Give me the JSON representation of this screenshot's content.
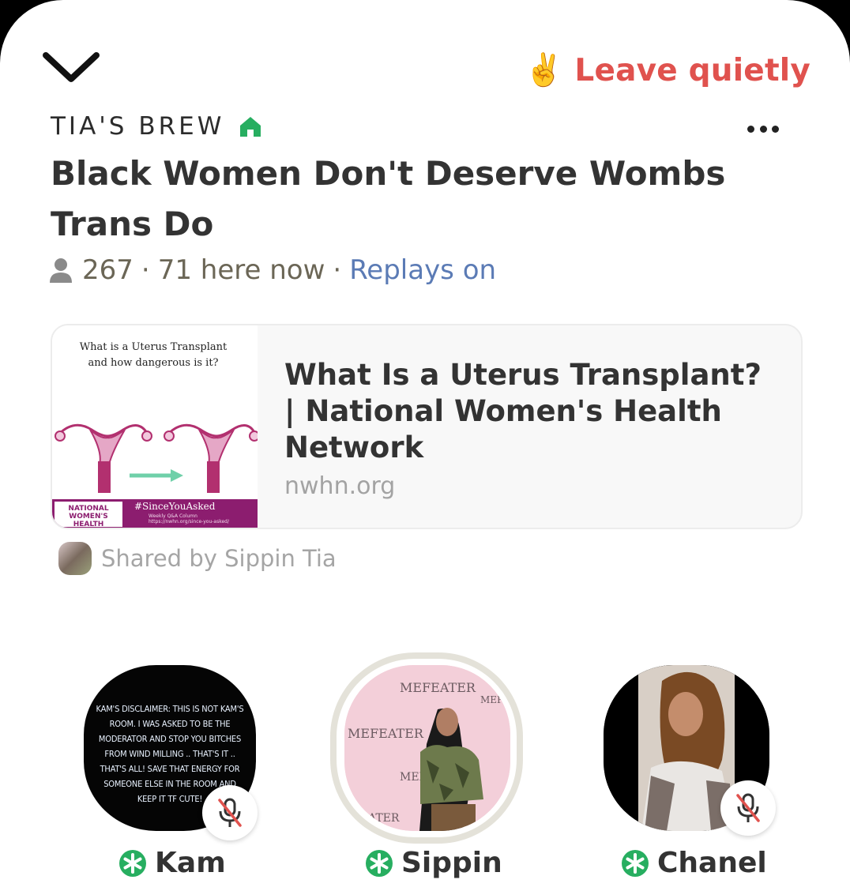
{
  "header": {
    "leave_label": "Leave quietly",
    "leave_emoji": "✌️"
  },
  "room": {
    "club_name": "TIA'S BREW",
    "title": "Black Women Don't Deserve Wombs Trans Do",
    "listener_count": "267",
    "here_now": "71 here now",
    "replays": "Replays on"
  },
  "link_card": {
    "thumbnail_caption": "What is a Uterus Transplant and how dangerous is it?",
    "thumbnail_org": "NATIONAL WOMEN'S HEALTH NETWORK",
    "thumbnail_tag": "#SinceYouAsked",
    "thumbnail_subtag": "Weekly Q&A Column https://nwhn.org/since-you-asked/",
    "title": "What Is a Uterus Transplant? | National Women's Health Network",
    "domain": "nwhn.org"
  },
  "shared_by": "Shared by Sippin Tia",
  "speakers": [
    {
      "name": "Kam",
      "avatar_text": "KAM'S DISCLAIMER: THIS IS NOT KAM'S ROOM. I WAS ASKED TO BE THE MODERATOR AND STOP YOU BITCHES FROM WIND MILLING .. THAT'S IT .. THAT'S ALL! SAVE THAT ENERGY FOR SOMEONE ELSE IN THE ROOM AND KEEP IT TF CUTE!",
      "muted": true
    },
    {
      "name": "Sippin",
      "avatar_text": "MEFEATER",
      "muted": false,
      "speaking": true
    },
    {
      "name": "Chanel",
      "muted": true
    }
  ],
  "colors": {
    "leave": "#e0524e",
    "replays": "#5b7bb5",
    "club_house": "#27ae60",
    "moderator_badge": "#27ae60"
  },
  "icons": [
    "chevron-down-icon",
    "peace-hand-icon",
    "house-icon",
    "more-icon",
    "person-icon",
    "mic-off-icon",
    "moderator-badge-icon"
  ]
}
